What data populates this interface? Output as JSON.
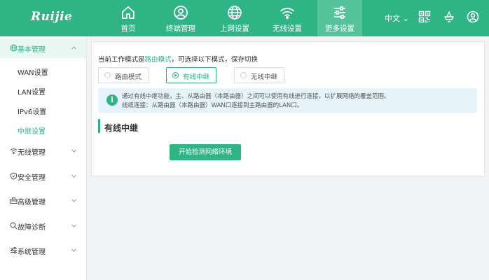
{
  "brand": {
    "logo_text": "Ruijie",
    "primary_color": "#2fb486",
    "active_tab_color": "#55c49c"
  },
  "nav": {
    "items": [
      {
        "label": "首页",
        "icon": "home-icon"
      },
      {
        "label": "终端管理",
        "icon": "user-icon"
      },
      {
        "label": "上网设置",
        "icon": "globe-icon"
      },
      {
        "label": "无线设置",
        "icon": "wifi-icon"
      },
      {
        "label": "更多设置",
        "icon": "sliders-icon",
        "active": true
      }
    ],
    "language": "中文",
    "right_icons": [
      "qrcode-icon",
      "hat-icon",
      "power-icon"
    ]
  },
  "sidebar": {
    "groups": [
      {
        "label": "基本管理",
        "icon": "globe-icon",
        "expanded": true,
        "items": [
          {
            "label": "WAN设置"
          },
          {
            "label": "LAN设置"
          },
          {
            "label": "IPv6设置"
          },
          {
            "label": "中继设置",
            "active": true
          }
        ]
      },
      {
        "label": "无线管理",
        "icon": "wifi-icon"
      },
      {
        "label": "安全管理",
        "icon": "shield-icon"
      },
      {
        "label": "高级管理",
        "icon": "toolbox-icon"
      },
      {
        "label": "故障诊断",
        "icon": "search-icon"
      },
      {
        "label": "系统管理",
        "icon": "settings-icon"
      }
    ]
  },
  "main": {
    "mode_prefix": "当前工作模式是",
    "current_mode": "路由模式",
    "mode_suffix": "，可选择以下模式，保存切换",
    "modes": [
      {
        "label": "路由模式",
        "selected": false
      },
      {
        "label": "有线中继",
        "selected": true
      },
      {
        "label": "无线中继",
        "selected": false
      }
    ],
    "info_line1": "通过有线中继功能，主、从路由器（本路由器）之间可以使用有线进行连接，以扩展网络的覆盖范围。",
    "info_line2": "线缆连接：从路由器（本路由器）WAN口连接到主路由器的LAN口。",
    "section_title": "有线中继",
    "start_button": "开始检测网络环境"
  }
}
